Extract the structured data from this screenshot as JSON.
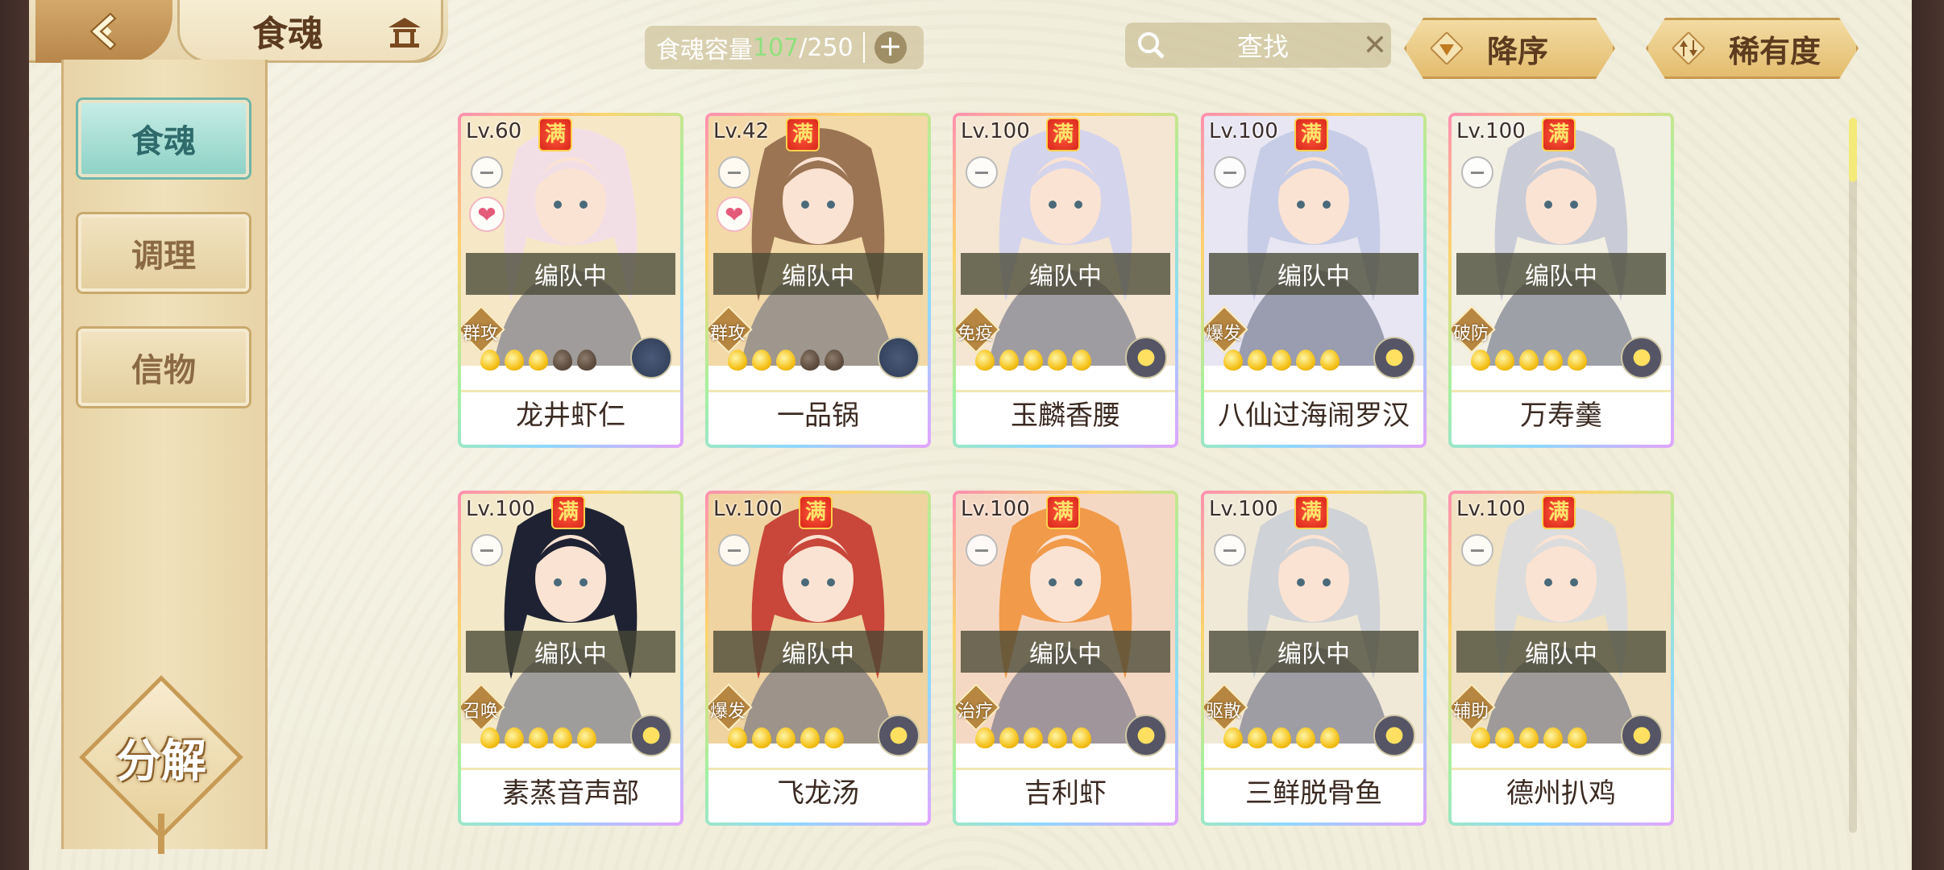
{
  "header": {
    "title": "食魂",
    "capacity_label": "食魂容量",
    "capacity_current": "107",
    "capacity_max": "/250",
    "search_placeholder": "查找",
    "sort_order_label": "降序",
    "sort_rarity_label": "稀有度"
  },
  "sidebar": {
    "items": [
      {
        "label": "食魂",
        "active": true
      },
      {
        "label": "调理",
        "active": false
      },
      {
        "label": "信物",
        "active": false
      }
    ],
    "decompose_label": "分解"
  },
  "colors": {
    "accent": "#8fd2c6",
    "capacity_current": "#8fe07f",
    "gold": "#e3bd6e"
  },
  "cards": [
    {
      "level": "Lv.60",
      "max": "满",
      "locked": true,
      "favorite": true,
      "status": "编队中",
      "role": "群攻",
      "stars_on": 3,
      "stars_total": 5,
      "name": "龙井虾仁",
      "hair": "#f2dfe6",
      "bg": "#f6e7c7",
      "emblem": "dark"
    },
    {
      "level": "Lv.42",
      "max": "满",
      "locked": true,
      "favorite": true,
      "status": "编队中",
      "role": "群攻",
      "stars_on": 3,
      "stars_total": 5,
      "name": "一品锅",
      "hair": "#9a7453",
      "bg": "#f3d9a8",
      "emblem": "dark"
    },
    {
      "level": "Lv.100",
      "max": "满",
      "locked": true,
      "favorite": false,
      "status": "编队中",
      "role": "免疫",
      "stars_on": 5,
      "stars_total": 5,
      "name": "玉麟香腰",
      "hair": "#d4d4ec",
      "bg": "#f4e6d2",
      "emblem": "gold"
    },
    {
      "level": "Lv.100",
      "max": "满",
      "locked": true,
      "favorite": false,
      "status": "编队中",
      "role": "爆发",
      "stars_on": 5,
      "stars_total": 5,
      "name": "八仙过海闹罗汉",
      "hair": "#c7cde6",
      "bg": "#e8e6f2",
      "emblem": "gold"
    },
    {
      "level": "Lv.100",
      "max": "满",
      "locked": true,
      "favorite": false,
      "status": "编队中",
      "role": "破防",
      "stars_on": 5,
      "stars_total": 5,
      "name": "万寿羹",
      "hair": "#c9ccd6",
      "bg": "#f2efe3",
      "emblem": "gold"
    },
    {
      "level": "Lv.100",
      "max": "满",
      "locked": true,
      "favorite": false,
      "status": "编队中",
      "role": "召唤",
      "stars_on": 5,
      "stars_total": 5,
      "name": "素蒸音声部",
      "hair": "#1f2233",
      "bg": "#f3e8c8",
      "emblem": "gold"
    },
    {
      "level": "Lv.100",
      "max": "满",
      "locked": true,
      "favorite": false,
      "status": "编队中",
      "role": "爆发",
      "stars_on": 5,
      "stars_total": 5,
      "name": "飞龙汤",
      "hair": "#c8463a",
      "bg": "#efd3a0",
      "emblem": "gold"
    },
    {
      "level": "Lv.100",
      "max": "满",
      "locked": true,
      "favorite": false,
      "status": "编队中",
      "role": "治疗",
      "stars_on": 5,
      "stars_total": 5,
      "name": "吉利虾",
      "hair": "#f09a4a",
      "bg": "#f5d8c4",
      "emblem": "gold"
    },
    {
      "level": "Lv.100",
      "max": "满",
      "locked": true,
      "favorite": false,
      "status": "编队中",
      "role": "驱散",
      "stars_on": 5,
      "stars_total": 5,
      "name": "三鲜脱骨鱼",
      "hair": "#cfd2d6",
      "bg": "#f1e9d8",
      "emblem": "gold"
    },
    {
      "level": "Lv.100",
      "max": "满",
      "locked": true,
      "favorite": false,
      "status": "编队中",
      "role": "辅助",
      "stars_on": 5,
      "stars_total": 5,
      "name": "德州扒鸡",
      "hair": "#dcdcdc",
      "bg": "#f0e2c2",
      "emblem": "gold"
    }
  ]
}
